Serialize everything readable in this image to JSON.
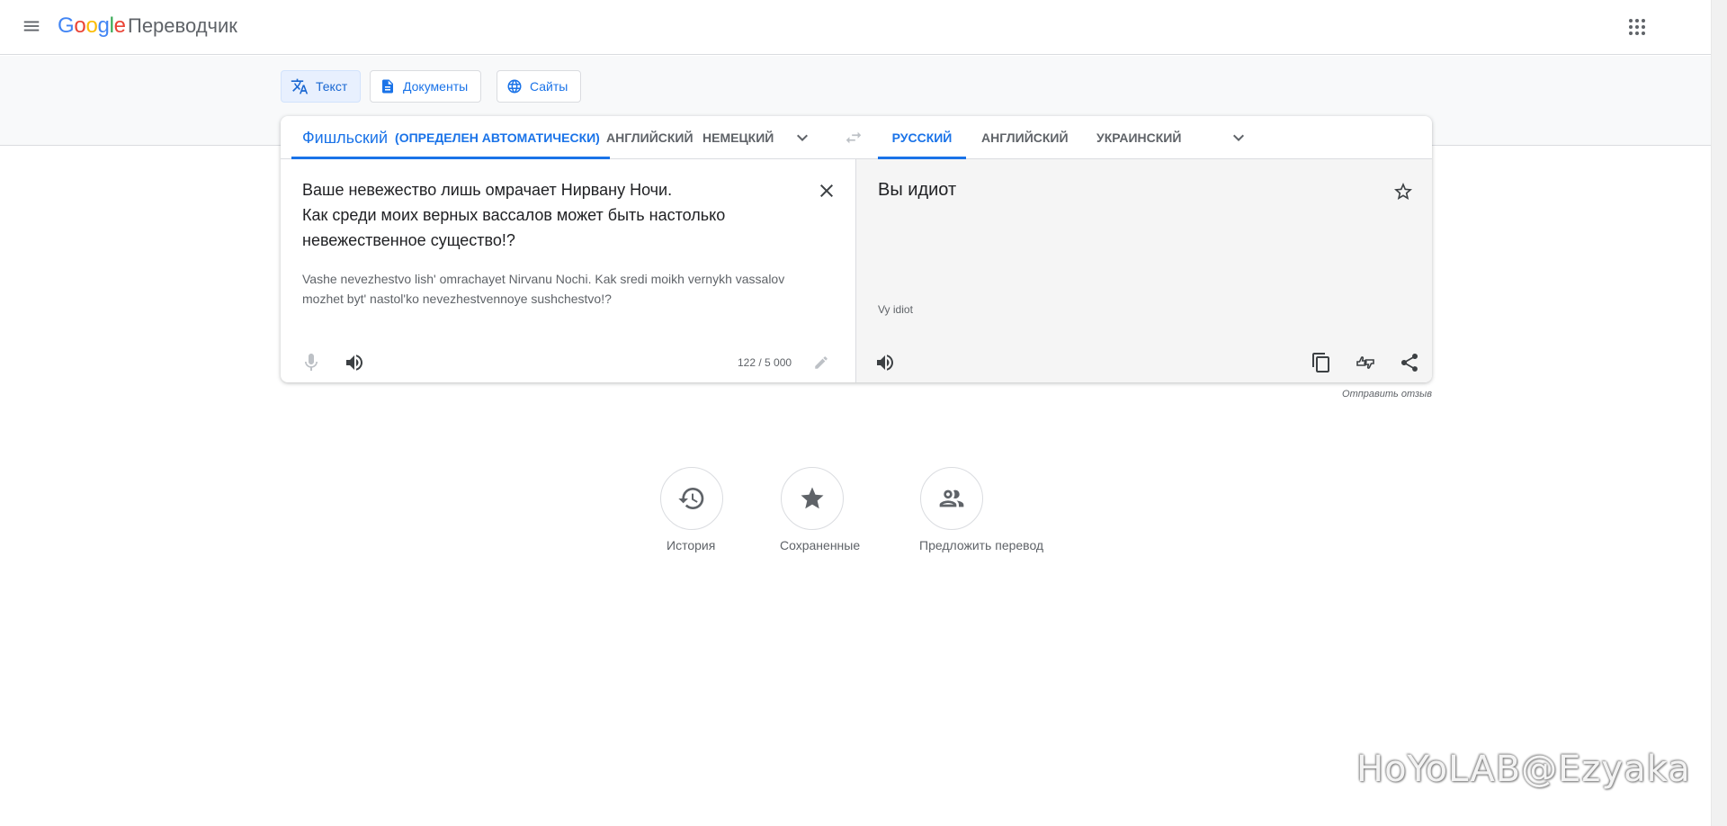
{
  "header": {
    "logo_letters": [
      "G",
      "o",
      "o",
      "g",
      "l",
      "e"
    ],
    "app_name": "Переводчик",
    "icons": {
      "menu": "menu-icon",
      "apps": "apps-grid-icon"
    }
  },
  "modes": [
    {
      "label": "Текст",
      "icon": "translate-icon",
      "active": true
    },
    {
      "label": "Документы",
      "icon": "document-icon",
      "active": false
    },
    {
      "label": "Сайты",
      "icon": "globe-icon",
      "active": false
    }
  ],
  "source_langs": {
    "detected": "Фишльский",
    "detected_note": "(ОПРЕДЕЛЕН АВТОМАТИЧЕСКИ)",
    "option1": "АНГЛИЙСКИЙ",
    "option2": "НЕМЕЦКИЙ"
  },
  "target_langs": {
    "active": "РУССКИЙ",
    "option1": "АНГЛИЙСКИЙ",
    "option2": "УКРАИНСКИЙ"
  },
  "source": {
    "line1": "Ваше невежество лишь омрачает Нирвану Ночи.",
    "line2": "Как среди моих верных вассалов может быть настолько",
    "line3": "невежественное существо!?",
    "transliteration": "Vashe nevezhestvo lish' omrachayet Nirvanu Nochi. Kak sredi moikh vernykh vassalov mozhet byt' nastol'ko nevezhestvennoye sushchestvo!?",
    "counter": "122 / 5 000"
  },
  "target": {
    "text": "Вы идиот",
    "transliteration": "Vy idiot"
  },
  "feedback": "Отправить отзыв",
  "shortcuts": [
    {
      "label": "История",
      "icon": "history-icon"
    },
    {
      "label": "Сохраненные",
      "icon": "star-filled-icon"
    },
    {
      "label": "Предложить перевод",
      "icon": "people-icon"
    }
  ],
  "watermark": "HoYoLAB@Ezyaka",
  "colors": {
    "accent": "#1a73e8",
    "text": "#202124",
    "muted": "#5f6368",
    "target_bg": "#f5f5f5"
  }
}
